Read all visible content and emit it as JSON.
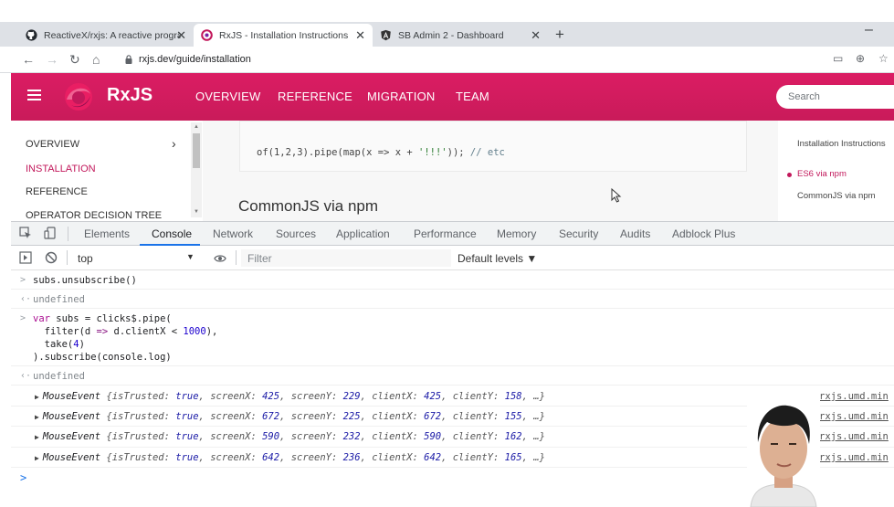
{
  "browser": {
    "tabs": [
      {
        "title": "ReactiveX/rxjs: A reactive progra",
        "icon": "github-icon",
        "active": false
      },
      {
        "title": "RxJS - Installation Instructions",
        "icon": "rxjs-icon",
        "active": true
      },
      {
        "title": "SB Admin 2 - Dashboard",
        "icon": "angular-icon",
        "active": false
      }
    ],
    "new_tab": "+",
    "minimize": "–",
    "url": "rxjs.dev/guide/installation"
  },
  "site": {
    "brand": "RxJS",
    "nav": [
      "OVERVIEW",
      "REFERENCE",
      "MIGRATION",
      "TEAM"
    ],
    "search_placeholder": "Search",
    "accent": "#d81b60"
  },
  "sidenav": {
    "items": [
      "OVERVIEW",
      "INSTALLATION",
      "REFERENCE",
      "OPERATOR DECISION TREE"
    ],
    "active": "INSTALLATION"
  },
  "content": {
    "code_prefix": "of(1,2,3).pipe(map(x => x + ",
    "code_string": "'!!!'",
    "code_suffix": ")); ",
    "code_comment": "// etc",
    "heading": "CommonJS via npm"
  },
  "toc": {
    "items": [
      "Installation Instructions",
      "ES6 via npm",
      "CommonJS via npm"
    ],
    "active": "ES6 via npm"
  },
  "devtools": {
    "tabs": [
      "Elements",
      "Console",
      "Network",
      "Sources",
      "Application",
      "Performance",
      "Memory",
      "Security",
      "Audits",
      "Adblock Plus"
    ],
    "active_tab": "Console",
    "context": "top",
    "filter_placeholder": "Filter",
    "levels": "Default levels ▼"
  },
  "console": {
    "cmd1": "subs.unsubscribe()",
    "undefined": "undefined",
    "cmd2": {
      "l1_kw": "var",
      "l1_rest": " subs = clicks$.pipe(",
      "l2_a": "  filter(d ",
      "l2_op": "=>",
      "l2_b": " d.clientX < ",
      "l2_num": "1000",
      "l2_c": "),",
      "l3_a": "  take(",
      "l3_num": "4",
      "l3_b": ")",
      "l4": ").subscribe(console.log)"
    },
    "events": [
      {
        "screenX": "425",
        "screenY": "229",
        "clientX": "425",
        "clientY": "158"
      },
      {
        "screenX": "672",
        "screenY": "225",
        "clientX": "672",
        "clientY": "155"
      },
      {
        "screenX": "590",
        "screenY": "232",
        "clientX": "590",
        "clientY": "162"
      },
      {
        "screenX": "642",
        "screenY": "236",
        "clientX": "642",
        "clientY": "165"
      }
    ],
    "event_name": "MouseEvent",
    "is_trusted": "true",
    "source": "rxjs.umd.min",
    "prompt": ">"
  }
}
